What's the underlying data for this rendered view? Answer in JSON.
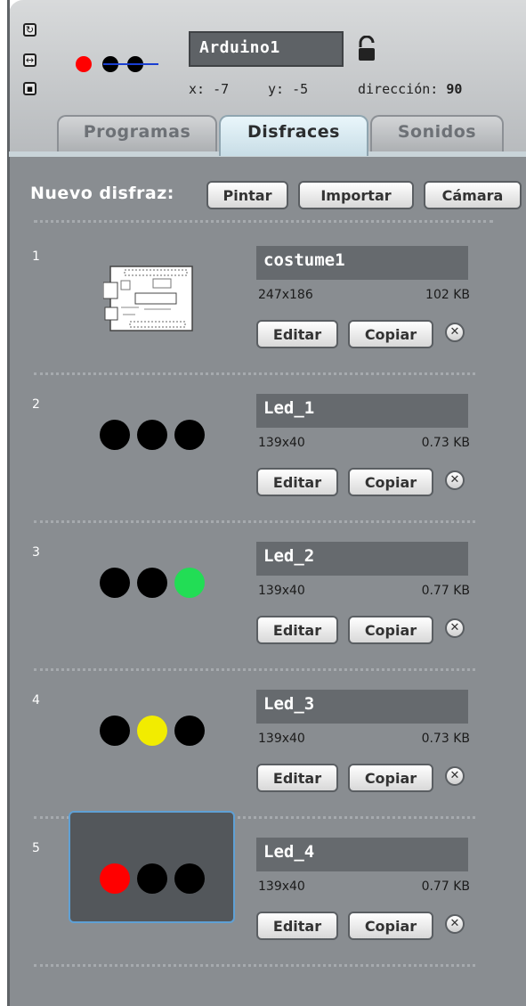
{
  "sprite": {
    "name": "Arduino1",
    "x_label": "x:",
    "x_value": "-7",
    "y_label": "y:",
    "y_value": "-5",
    "direction_label": "dirección:",
    "direction_value": "90"
  },
  "rotation_buttons": [
    "rotate-icon",
    "flip-icon",
    "no-rotate-icon"
  ],
  "tabs": [
    {
      "label": "Programas",
      "active": false
    },
    {
      "label": "Disfraces",
      "active": true
    },
    {
      "label": "Sonidos",
      "active": false
    }
  ],
  "new_costume": {
    "label": "Nuevo disfraz:",
    "paint_label": "Pintar",
    "import_label": "Importar",
    "camera_label": "Cámara"
  },
  "costume_buttons": {
    "edit_label": "Editar",
    "copy_label": "Copiar",
    "delete_glyph": "✕"
  },
  "costumes": [
    {
      "number": "1",
      "name": "costume1",
      "dims": "247x186",
      "size": "102 KB",
      "leds": null,
      "selected": false
    },
    {
      "number": "2",
      "name": "Led_1",
      "dims": "139x40",
      "size": "0.73 KB",
      "leds": [
        "#000000",
        "#000000",
        "#000000"
      ],
      "selected": false
    },
    {
      "number": "3",
      "name": "Led_2",
      "dims": "139x40",
      "size": "0.77 KB",
      "leds": [
        "#000000",
        "#000000",
        "#22dd55"
      ],
      "selected": false
    },
    {
      "number": "4",
      "name": "Led_3",
      "dims": "139x40",
      "size": "0.73 KB",
      "leds": [
        "#000000",
        "#f2ec00",
        "#000000"
      ],
      "selected": false
    },
    {
      "number": "5",
      "name": "Led_4",
      "dims": "139x40",
      "size": "0.77 KB",
      "leds": [
        "#ff0000",
        "#000000",
        "#000000"
      ],
      "selected": true
    }
  ],
  "colors": {
    "panel": "#898d91",
    "selected_border": "#5fa0d5",
    "name_field": "#666a6e"
  }
}
